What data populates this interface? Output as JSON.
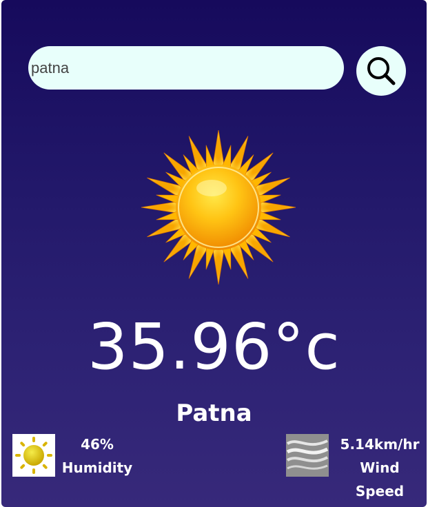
{
  "search": {
    "value": "patna",
    "button_icon": "search-icon"
  },
  "weather": {
    "icon": "sun-icon",
    "temperature": "35.96°c",
    "city": "Patna"
  },
  "details": {
    "humidity": {
      "icon": "humidity-sun-icon",
      "value": "46%",
      "label": "Humidity"
    },
    "wind": {
      "icon": "wind-icon",
      "value": "5.14km/hr",
      "label": "Wind Speed"
    }
  },
  "colors": {
    "background_top": "#160a5c",
    "background_bottom": "#37297a",
    "input_background": "#e8fffb",
    "text": "#ffffff"
  }
}
